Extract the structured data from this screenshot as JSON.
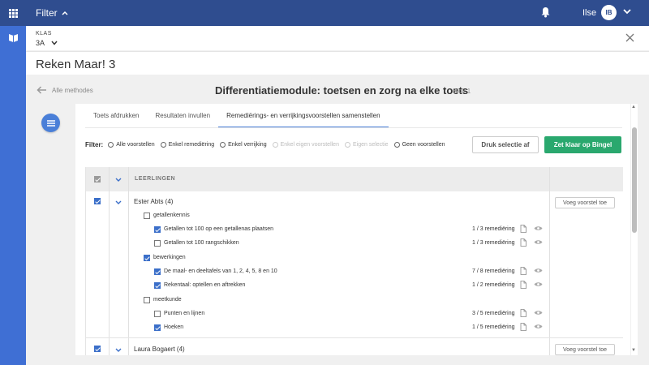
{
  "topbar": {
    "filter_label": "Filter",
    "user_name": "Ilse",
    "avatar_initials": "IB"
  },
  "klas": {
    "label": "KLAS",
    "value": "3A"
  },
  "page_title": "Reken Maar! 3",
  "module": {
    "back_label": "Alle methodes",
    "title": "Differentiatiemodule: toetsen en zorg na elke toets",
    "blok": "Blok 1"
  },
  "tabs": [
    {
      "label": "Toets afdrukken",
      "active": false
    },
    {
      "label": "Resultaten invullen",
      "active": false
    },
    {
      "label": "Remediërings- en verrijkingsvoorstellen samenstellen",
      "active": true
    }
  ],
  "filter": {
    "label": "Filter:",
    "options": [
      {
        "label": "Alle voorstellen",
        "disabled": false
      },
      {
        "label": "Enkel remediëring",
        "disabled": false
      },
      {
        "label": "Enkel verrijking",
        "disabled": false
      },
      {
        "label": "Enkel eigen voorstellen",
        "disabled": true
      },
      {
        "label": "Eigen selectie",
        "disabled": true
      },
      {
        "label": "Geen voorstellen",
        "disabled": false
      }
    ]
  },
  "actions": {
    "print_label": "Druk selectie af",
    "ready_label": "Zet klaar op Bingel"
  },
  "table": {
    "header_label": "LEERLINGEN",
    "add_proposal_label": "Voeg voorstel toe",
    "students": [
      {
        "name": "Ester Abts (4)",
        "groups": [
          {
            "name": "getallenkennis",
            "items": [
              {
                "name": "Getallen tot 100 op een getallenas plaatsen",
                "count": "1 / 3 remediëring",
                "checked": true
              },
              {
                "name": "Getallen tot 100 rangschikken",
                "count": "1 / 3 remediëring",
                "checked": false
              }
            ]
          },
          {
            "name": "bewerkingen",
            "items": [
              {
                "name": "De maal- en deeltafels van 1, 2, 4, 5, 8 en 10",
                "count": "7 / 8 remediëring",
                "checked": true
              },
              {
                "name": "Rekentaal: optellen en aftrekken",
                "count": "1 / 2 remediëring",
                "checked": true
              }
            ]
          },
          {
            "name": "meetkunde",
            "items": [
              {
                "name": "Punten en lijnen",
                "count": "3 / 5 remediëring",
                "checked": false
              },
              {
                "name": "Hoeken",
                "count": "1 / 5 remediëring",
                "checked": true
              }
            ]
          }
        ]
      },
      {
        "name": "Laura Bogaert (4)"
      }
    ]
  },
  "colors": {
    "topbar": "#2f4d8f",
    "rail": "#3f6fd4",
    "accent": "#4a7fd8",
    "green": "#2aa86e"
  }
}
